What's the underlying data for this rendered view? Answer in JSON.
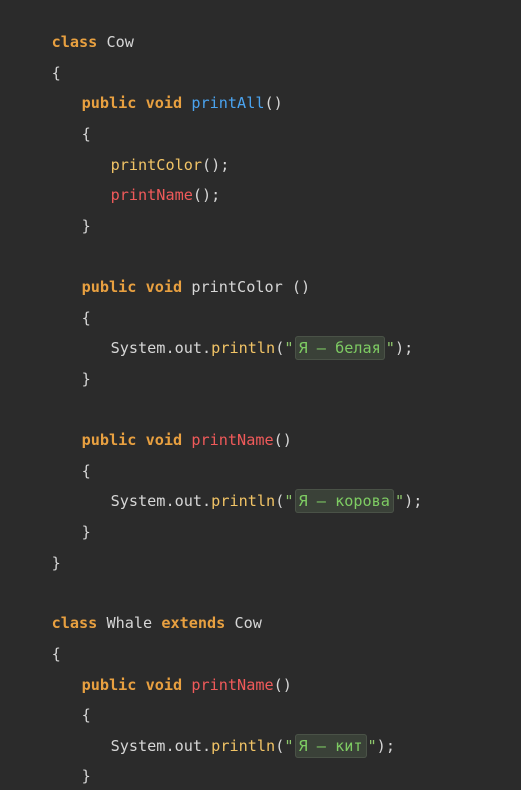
{
  "code": {
    "l1": {
      "t1": "class",
      "t2": " Cow"
    },
    "l2": {
      "t1": "{"
    },
    "l3": {
      "t1": "public",
      "t2": " ",
      "t3": "void",
      "t4": " ",
      "t5": "printAll",
      "t6": "()"
    },
    "l4": {
      "t1": "{"
    },
    "l5": {
      "t1": "printColor",
      "t2": "();"
    },
    "l6": {
      "t1": "printName",
      "t2": "();"
    },
    "l7": {
      "t1": "}"
    },
    "l8": {
      "t1": "public",
      "t2": " ",
      "t3": "void",
      "t4": " printColor ()"
    },
    "l9": {
      "t1": "{"
    },
    "l10": {
      "t1": "System.out.",
      "t2": "println",
      "t3": "(",
      "t4": "\"",
      "t5": "Я — белая",
      "t6": "\"",
      "t7": ");"
    },
    "l11": {
      "t1": "}"
    },
    "l12": {
      "t1": "public",
      "t2": " ",
      "t3": "void",
      "t4": " ",
      "t5": "printName",
      "t6": "()"
    },
    "l13": {
      "t1": "{"
    },
    "l14": {
      "t1": "System.out.",
      "t2": "println",
      "t3": "(",
      "t4": "\"",
      "t5": "Я — корова",
      "t6": "\"",
      "t7": ");"
    },
    "l15": {
      "t1": "}"
    },
    "l16": {
      "t1": "}"
    },
    "l17": {
      "t1": "class",
      "t2": " Whale ",
      "t3": "extends",
      "t4": " Cow"
    },
    "l18": {
      "t1": "{"
    },
    "l19": {
      "t1": "public",
      "t2": " ",
      "t3": "void",
      "t4": " ",
      "t5": "printName",
      "t6": "()"
    },
    "l20": {
      "t1": "{"
    },
    "l21": {
      "t1": "System.out.",
      "t2": "println",
      "t3": "(",
      "t4": "\"",
      "t5": "Я — кит",
      "t6": "\"",
      "t7": ");"
    },
    "l22": {
      "t1": "}"
    },
    "l23": {
      "t1": "}"
    }
  }
}
